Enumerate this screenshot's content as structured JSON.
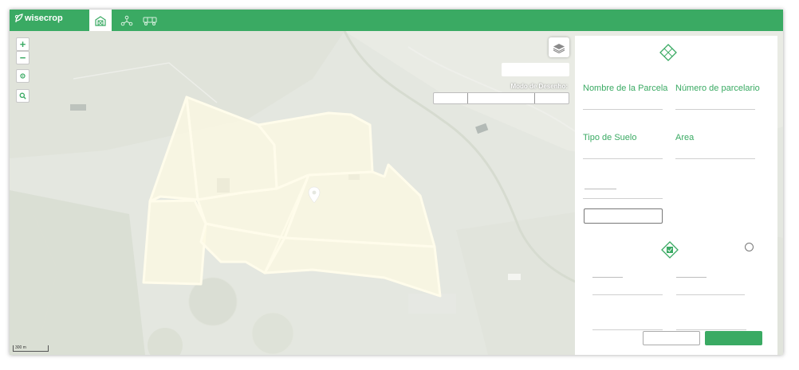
{
  "app": {
    "logo_text": "wisecrop"
  },
  "nav": {
    "tabs": [
      {
        "icon": "farm-icon",
        "active": true
      },
      {
        "icon": "network-icon",
        "active": false
      },
      {
        "icon": "machinery-icon",
        "active": false
      }
    ]
  },
  "map": {
    "zoom_in": "+",
    "zoom_out": "−",
    "draw_mode_label": "Modo de Desenho:",
    "scale_label": "300 m"
  },
  "panel": {
    "parcel_name_label": "Nombre de la Parcela",
    "parcel_number_label": "Número de parcelario",
    "soil_type_label": "Tipo de Suelo",
    "area_label": "Area"
  },
  "colors": {
    "accent": "#3aaa63",
    "parcel_fill": "#fbf6d3",
    "parcel_stroke": "#fffbe0"
  }
}
